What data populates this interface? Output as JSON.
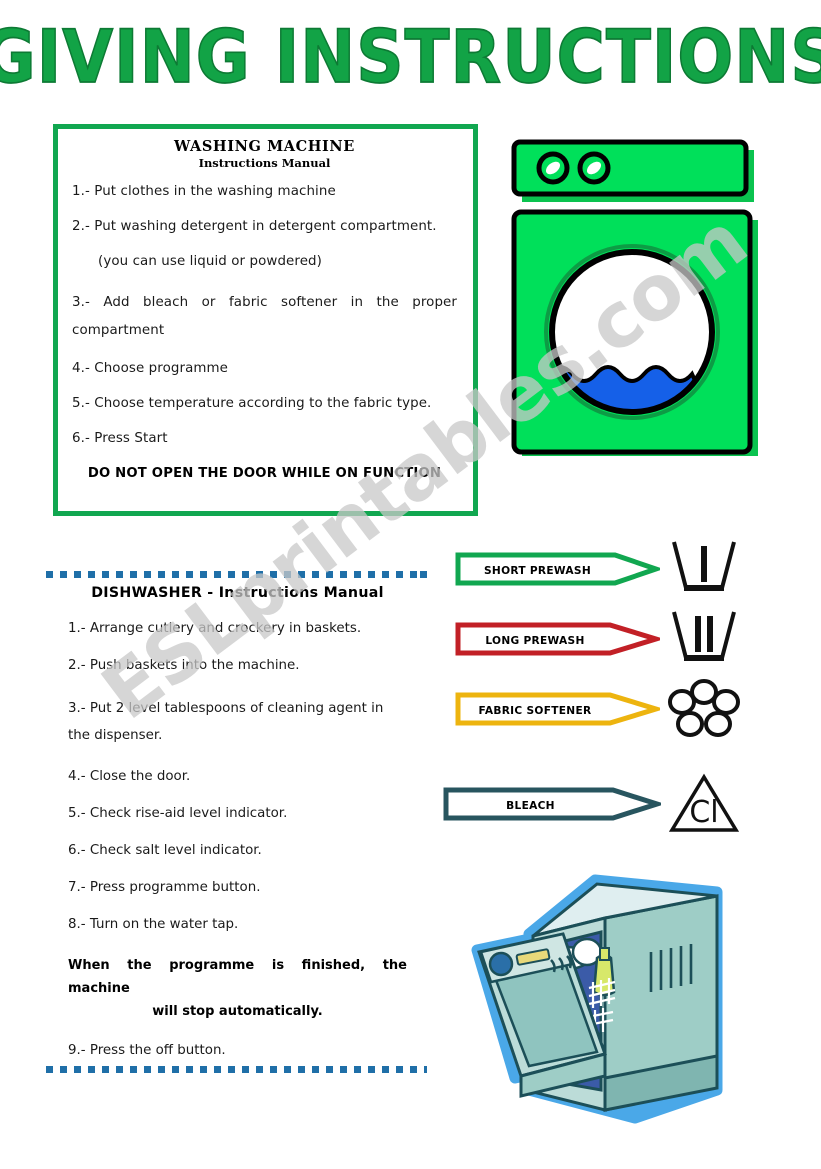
{
  "page": {
    "title": "GIVING INSTRUCTIONS",
    "watermark": "ESLprintables.com"
  },
  "washing_machine": {
    "heading": "WASHING  MACHINE",
    "subheading": "Instructions Manual",
    "steps": [
      "1.- Put clothes in the washing machine",
      "2.- Put washing detergent in detergent compartment.",
      "(you can use liquid or powdered)",
      "3.- Add bleach or fabric softener in the proper compartment",
      "4.- Choose programme",
      "5.- Choose temperature according to the fabric type.",
      "6.- Press Start"
    ],
    "warning": "DO NOT OPEN THE DOOR WHILE ON FUNCTION",
    "colors": {
      "border": "#11a750",
      "body": "#00e05a",
      "door_water": "#1560e8",
      "door_foam": "#ffffff"
    }
  },
  "dishwasher": {
    "heading": "DISHWASHER  -  Instructions  Manual",
    "steps": [
      "1.- Arrange cutlery and  crockery in baskets.",
      "2.- Push baskets into the machine.",
      "3.- Put 2 level tablespoons of cleaning agent in the dispenser.",
      "4.- Close the door.",
      "5.- Check rise-aid level indicator.",
      "6.- Check salt level indicator.",
      "7.- Press programme button.",
      "8.- Turn on the water tap."
    ],
    "note_line1": "When the programme is finished, the machine",
    "note_line2": "will stop automatically.",
    "final_step": "9.- Press the off button.",
    "colors": {
      "border": "#1f6fa8",
      "body": "#a8d4cd",
      "interior": "#3b5ba8"
    }
  },
  "symbols": [
    {
      "label": "SHORT  PREWASH",
      "color": "#11a750",
      "glyph": "tub-one-bar-icon"
    },
    {
      "label": "LONG PREWASH",
      "color": "#c22026",
      "glyph": "tub-two-bars-icon"
    },
    {
      "label": "FABRIC SOFTENER",
      "color": "#edb40f",
      "glyph": "flower-icon"
    },
    {
      "label": "BLEACH",
      "color": "#28555f",
      "glyph": "triangle-cl-icon"
    }
  ]
}
